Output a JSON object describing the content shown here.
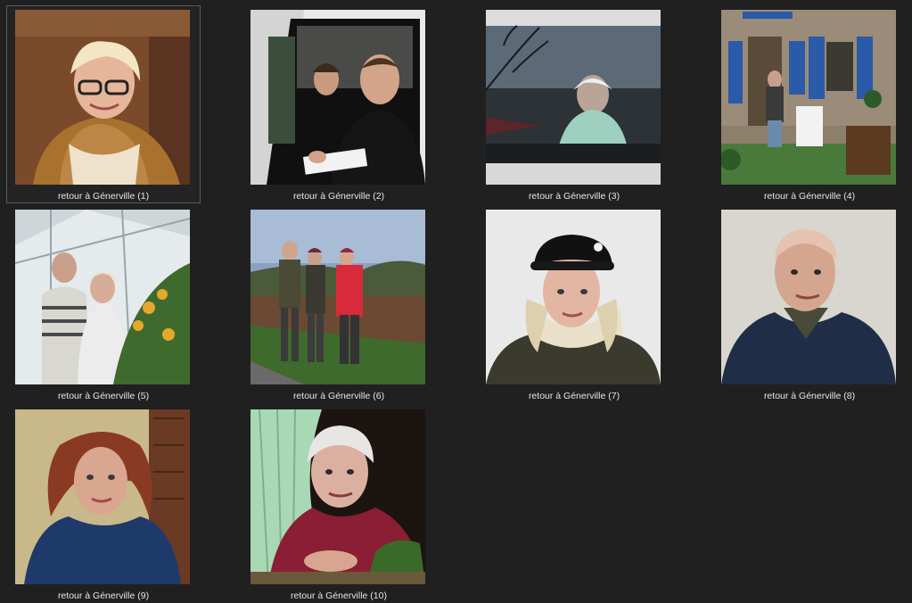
{
  "gallery": {
    "items": [
      {
        "caption": "retour à Génerville (1)",
        "thumb_icon": "portrait-photo-thumbnail",
        "selected": true
      },
      {
        "caption": "retour à Génerville (2)",
        "thumb_icon": "portrait-photo-thumbnail",
        "selected": false
      },
      {
        "caption": "retour à Génerville (3)",
        "thumb_icon": "portrait-photo-thumbnail",
        "selected": false
      },
      {
        "caption": "retour à Génerville (4)",
        "thumb_icon": "portrait-photo-thumbnail",
        "selected": false
      },
      {
        "caption": "retour à Génerville (5)",
        "thumb_icon": "portrait-photo-thumbnail",
        "selected": false
      },
      {
        "caption": "retour à Génerville (6)",
        "thumb_icon": "portrait-photo-thumbnail",
        "selected": false
      },
      {
        "caption": "retour à Génerville (7)",
        "thumb_icon": "portrait-photo-thumbnail",
        "selected": false
      },
      {
        "caption": "retour à Génerville (8)",
        "thumb_icon": "portrait-photo-thumbnail",
        "selected": false
      },
      {
        "caption": "retour à Génerville (9)",
        "thumb_icon": "portrait-photo-thumbnail",
        "selected": false
      },
      {
        "caption": "retour à Génerville (10)",
        "thumb_icon": "portrait-photo-thumbnail",
        "selected": false
      }
    ]
  },
  "colors": {
    "background": "#202020",
    "caption_text": "#e6e6e6",
    "selection_border": "#5a5a5a"
  }
}
